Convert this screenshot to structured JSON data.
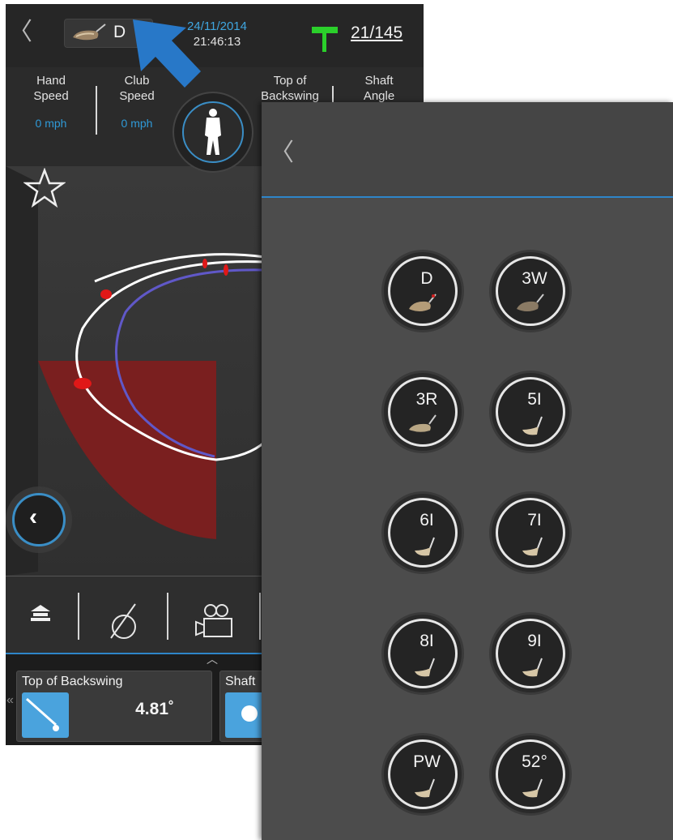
{
  "header": {
    "selected_club": "D",
    "date": "24/11/2014",
    "time": "21:46:13",
    "swing_count": "21/145"
  },
  "metrics": [
    {
      "label": "Hand\nSpeed",
      "value": "0 mph"
    },
    {
      "label": "Club\nSpeed",
      "value": "0 mph"
    },
    {
      "label": "Top of\nBackswing",
      "value": ""
    },
    {
      "label": "Shaft\nAngle",
      "value": ""
    }
  ],
  "bottom": {
    "card1_title": "Top of Backswing",
    "card1_value": "4.81˚",
    "card2_title": "Shaft"
  },
  "clubs": [
    "D",
    "3W",
    "3R",
    "5I",
    "6I",
    "7I",
    "8I",
    "9I",
    "PW",
    "52°"
  ],
  "colors": {
    "accent": "#2e86c9",
    "tee_marker": "#2bd02b",
    "zone": "#7a1f1f"
  }
}
